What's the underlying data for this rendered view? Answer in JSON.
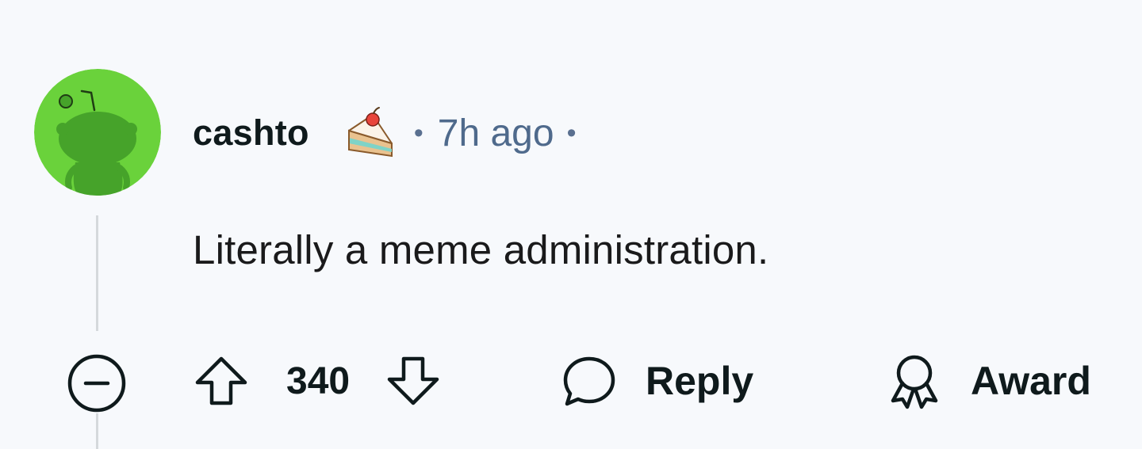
{
  "comment": {
    "author": "cashto",
    "separator": "•",
    "time_ago": "7h ago",
    "text": "Literally a meme administration.",
    "score": "340",
    "actions": {
      "reply_label": "Reply",
      "award_label": "Award"
    }
  },
  "colors": {
    "background": "#f7f9fc",
    "avatar_bg": "#6ad23b",
    "avatar_figure": "#46a32a",
    "timestamp": "#4f6a8c",
    "thread_line": "#d5d9dc"
  },
  "icons": {
    "avatar": "snoo-avatar-icon",
    "cake_day": "cake-day-icon",
    "collapse": "collapse-thread-icon",
    "upvote": "upvote-arrow-icon",
    "downvote": "downvote-arrow-icon",
    "reply": "speech-bubble-icon",
    "award": "award-ribbon-icon"
  }
}
